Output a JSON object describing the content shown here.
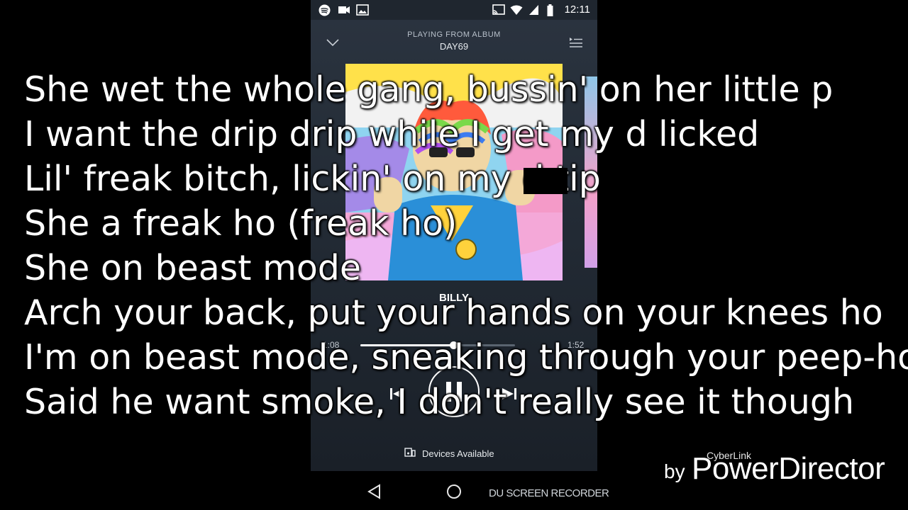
{
  "status_bar": {
    "time": "12:11",
    "left_icons": [
      "spotify-icon",
      "video-icon",
      "image-icon"
    ],
    "right_icons": [
      "cast-icon",
      "wifi-icon",
      "signal-icon",
      "battery-icon"
    ]
  },
  "player": {
    "playing_from_label": "PLAYING FROM ALBUM",
    "album": "DAY69",
    "track_title": "BILLY",
    "elapsed": "1:08",
    "total": "1:52",
    "progress": 0.6,
    "devices_label": "Devices Available",
    "icons": [
      "chevron-down-icon",
      "queue-icon",
      "previous-icon",
      "pause-icon",
      "next-icon",
      "devices-icon"
    ]
  },
  "lyrics": {
    "lines": [
      "She wet the whole gang, bussin' on her little p",
      "I want the drip drip while I get my d       licked",
      "Lil' freak bitch, lickin' on my d        tip",
      "She a freak ho (freak ho)",
      "She on beast mode",
      "Arch your back, put your hands on your knees ho",
      "I'm on beast mode, sneaking through your peep-hole",
      "Said he want smoke, I don't really see it though"
    ]
  },
  "nav_bar": {
    "icons": [
      "back-icon",
      "home-icon"
    ],
    "recorder_label": "DU SCREEN RECORDER"
  },
  "watermark": {
    "brand": "CyberLink",
    "by": "by",
    "product": "PowerDirector"
  },
  "colors": {
    "phone_bg": "#222a34",
    "lyrics_text": "#ffffff",
    "background": "#000000"
  }
}
